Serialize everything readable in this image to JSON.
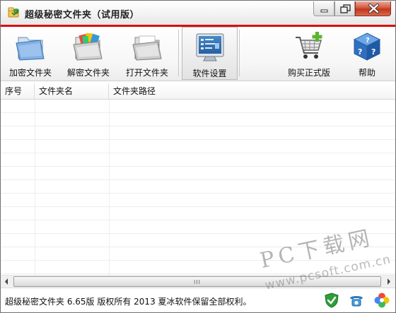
{
  "window": {
    "title": "超级秘密文件夹（试用版）",
    "controls": [
      "minimize-icon",
      "maximize-icon",
      "close-icon"
    ],
    "accent_color": "#d60f0f"
  },
  "toolbar": {
    "items": [
      {
        "label": "加密文件夹",
        "icon": "encrypt-folder-icon"
      },
      {
        "label": "解密文件夹",
        "icon": "decrypt-folder-icon"
      },
      {
        "label": "打开文件夹",
        "icon": "open-folder-icon"
      },
      {
        "label": "软件设置",
        "icon": "settings-monitor-icon",
        "selected": true
      },
      {
        "label": "购买正式版",
        "icon": "shopping-cart-icon"
      },
      {
        "label": "帮助",
        "icon": "help-cube-icon"
      }
    ]
  },
  "list": {
    "columns": [
      "序号",
      "文件夹名",
      "文件夹路径"
    ],
    "rows": []
  },
  "scrollbar": {
    "grip": "III"
  },
  "status": {
    "text": "超级秘密文件夹 6.65版 版权所有 2013 夏冰软件保留全部权利。",
    "icons": [
      "shield-check-icon",
      "phone-icon",
      "colorful-flower-icon"
    ]
  },
  "watermark": {
    "line1": "PC下载网",
    "line2": "www.pcsoft.com.cn"
  }
}
